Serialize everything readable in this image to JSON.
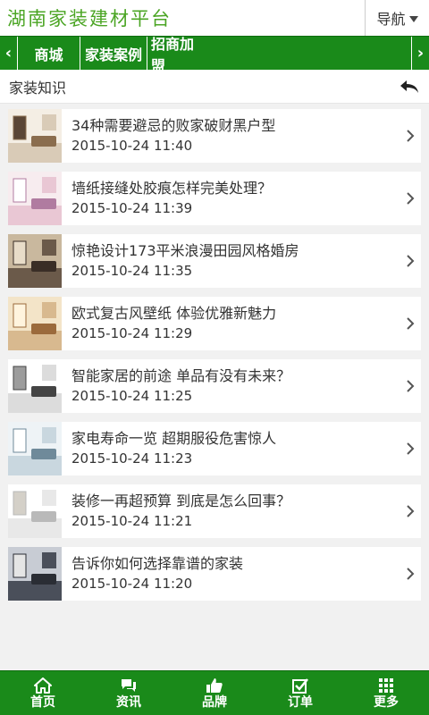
{
  "header": {
    "logo_text": "湖南家装建材平台",
    "nav_label": "导航"
  },
  "category_bar": {
    "items": [
      "商城",
      "家装案例",
      "招商加盟"
    ],
    "prev_icon": "chevron-left-icon",
    "next_icon": "chevron-right-icon"
  },
  "section": {
    "title": "家装知识",
    "back_icon": "back-arrow-icon"
  },
  "articles": [
    {
      "title": "34种需要避忌的败家破财黑户型",
      "date": "2015-10-24 11:40"
    },
    {
      "title": "墙纸接缝处胶痕怎样完美处理？",
      "date": "2015-10-24 11:39"
    },
    {
      "title": "惊艳设计173平米浪漫田园风格婚房",
      "date": "2015-10-24 11:35"
    },
    {
      "title": "欧式复古风壁纸 体验优雅新魅力",
      "date": "2015-10-24 11:29"
    },
    {
      "title": "智能家居的前途 单品有没有未来？",
      "date": "2015-10-24 11:25"
    },
    {
      "title": "家电寿命一览 超期服役危害惊人",
      "date": "2015-10-24 11:23"
    },
    {
      "title": "装修一再超预算 到底是怎么回事？",
      "date": "2015-10-24 11:21"
    },
    {
      "title": "告诉你如何选择靠谱的家装",
      "date": "2015-10-24 11:20"
    }
  ],
  "bottom_nav": [
    {
      "label": "首页",
      "icon": "home-icon"
    },
    {
      "label": "资讯",
      "icon": "chat-icon"
    },
    {
      "label": "品牌",
      "icon": "thumbs-up-icon"
    },
    {
      "label": "订单",
      "icon": "checkbox-icon"
    },
    {
      "label": "更多",
      "icon": "grid-icon"
    }
  ],
  "colors": {
    "brand_green": "#1a8a1a",
    "logo_green": "#4ba524",
    "background": "#f1f1f1"
  }
}
